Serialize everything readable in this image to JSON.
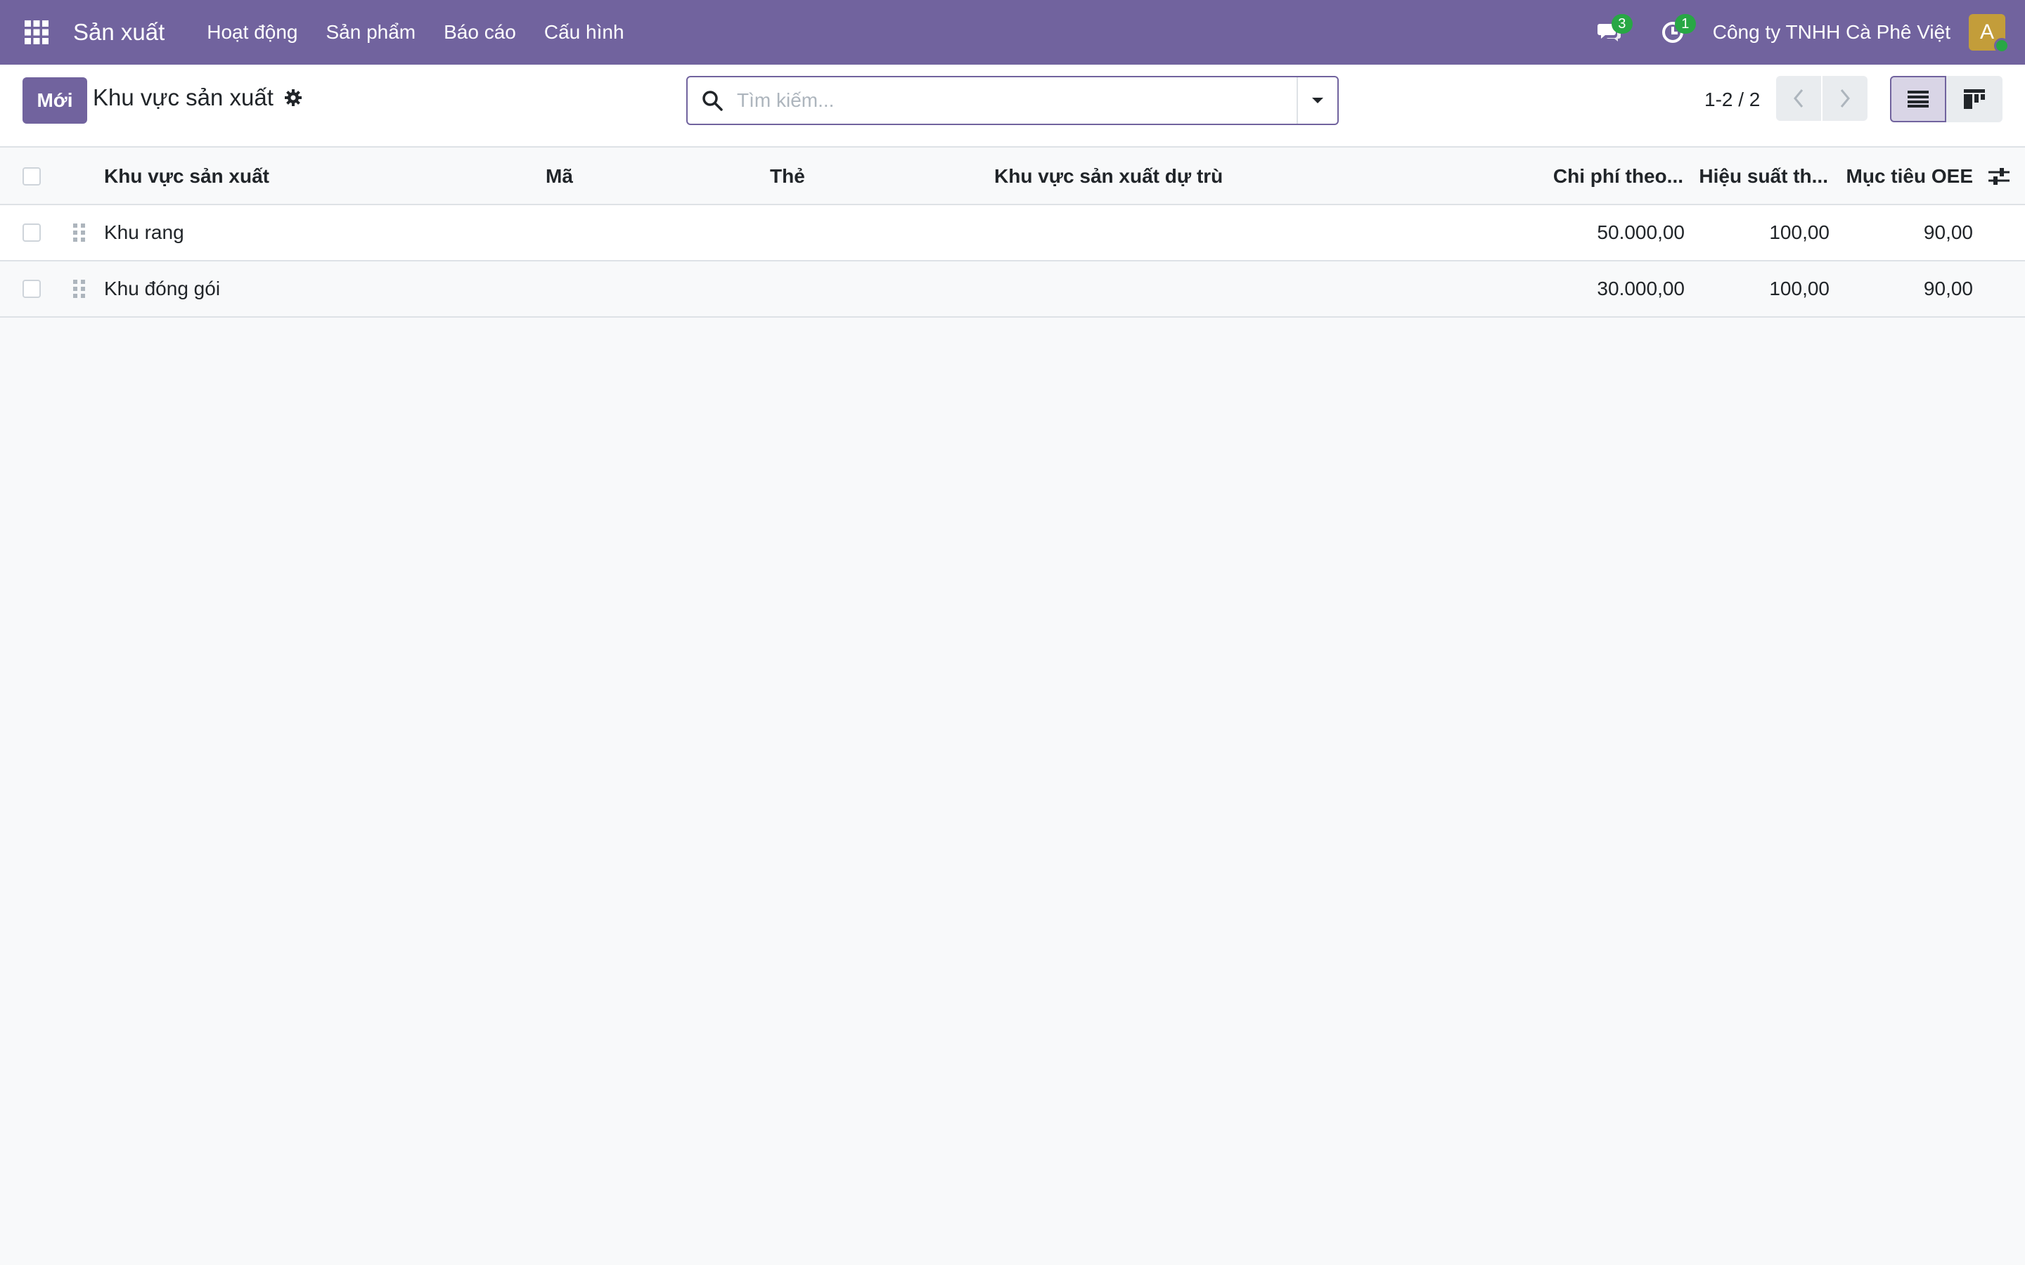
{
  "navbar": {
    "app_title": "Sản xuất",
    "menu": [
      "Hoạt động",
      "Sản phẩm",
      "Báo cáo",
      "Cấu hình"
    ],
    "messages_count": "3",
    "activities_count": "1",
    "company": "Công ty TNHH Cà Phê Việt",
    "avatar_letter": "A"
  },
  "control_panel": {
    "new_button": "Mới",
    "breadcrumb": "Khu vực sản xuất",
    "search_placeholder": "Tìm kiếm...",
    "pager": "1-2 / 2"
  },
  "table": {
    "columns": [
      "Khu vực sản xuất",
      "Mã",
      "Thẻ",
      "Khu vực sản xuất dự trù",
      "Chi phí theo...",
      "Hiệu suất th...",
      "Mục tiêu OEE"
    ],
    "rows": [
      {
        "name": "Khu rang",
        "code": "",
        "tags": "",
        "alternative": "",
        "cost": "50.000,00",
        "efficiency": "100,00",
        "oee": "90,00"
      },
      {
        "name": "Khu đóng gói",
        "code": "",
        "tags": "",
        "alternative": "",
        "cost": "30.000,00",
        "efficiency": "100,00",
        "oee": "90,00"
      }
    ]
  },
  "colors": {
    "brand": "#71639e",
    "badge": "#28a745",
    "avatar": "#c39d3a"
  }
}
